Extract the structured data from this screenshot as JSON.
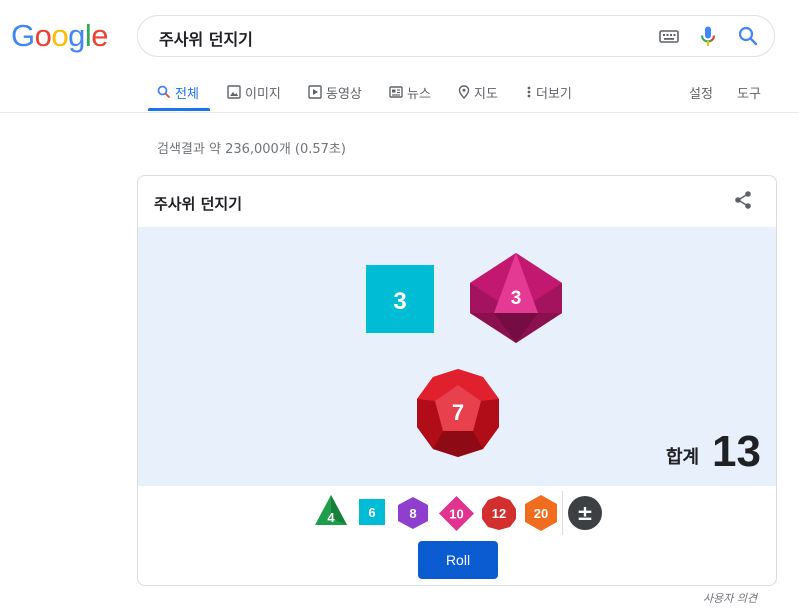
{
  "logo": {
    "letters": [
      "G",
      "o",
      "o",
      "g",
      "l",
      "e"
    ],
    "colors": [
      "#4285F4",
      "#EA4335",
      "#FBBC05",
      "#4285F4",
      "#34A853",
      "#EA4335"
    ]
  },
  "search": {
    "query": "주사위 던지기",
    "icons": [
      "keyboard-icon",
      "mic-icon",
      "search-icon"
    ]
  },
  "tabs": [
    {
      "label": "전체",
      "icon": "search-icon",
      "active": true
    },
    {
      "label": "이미지",
      "icon": "image-icon"
    },
    {
      "label": "동영상",
      "icon": "video-icon"
    },
    {
      "label": "뉴스",
      "icon": "news-icon"
    },
    {
      "label": "지도",
      "icon": "map-pin-icon"
    },
    {
      "label": "더보기",
      "icon": "more-vert-icon"
    }
  ],
  "tools": {
    "settings": "설정",
    "tools": "도구"
  },
  "result_stats": "검색결과 약 236,000개 (0.57초)",
  "dice_widget": {
    "title": "주사위 던지기",
    "share_icon": "share-icon",
    "rolled": [
      {
        "type": "d6",
        "value": "3",
        "color": "#00bcd4"
      },
      {
        "type": "d8",
        "value": "3",
        "color": "#d81b85"
      },
      {
        "type": "d12",
        "value": "7",
        "color": "#d61f2c"
      }
    ],
    "total_label": "합계",
    "total_value": "13",
    "selectors": [
      {
        "label": "4",
        "color": "#1e9e4a"
      },
      {
        "label": "6",
        "color": "#00bcd4"
      },
      {
        "label": "8",
        "color": "#8e3fce"
      },
      {
        "label": "10",
        "color": "#e0348f"
      },
      {
        "label": "12",
        "color": "#d32f2f"
      },
      {
        "label": "20",
        "color": "#f06d1f"
      },
      {
        "label": "±",
        "color": "#3c4043"
      }
    ],
    "roll_button": "Roll"
  },
  "feedback": "사용자 의견"
}
